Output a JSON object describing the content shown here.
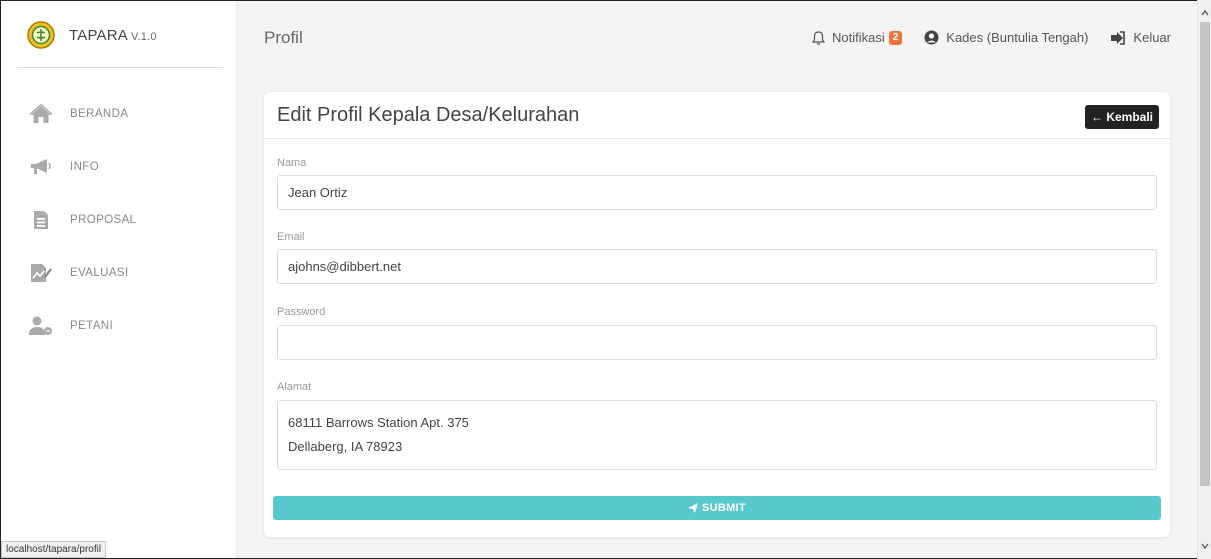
{
  "brand": {
    "name": "TAPARA",
    "version": "V.1.0"
  },
  "sidebar": {
    "items": [
      {
        "label": "BERANDA",
        "icon": "home-icon"
      },
      {
        "label": "INFO",
        "icon": "megaphone-icon"
      },
      {
        "label": "PROPOSAL",
        "icon": "document-icon"
      },
      {
        "label": "EVALUASI",
        "icon": "chart-pen-icon"
      },
      {
        "label": "PETANI",
        "icon": "user-group-icon"
      }
    ]
  },
  "topbar": {
    "title": "Profil",
    "notification_label": "Notifikasi",
    "notification_count": "2",
    "user_label": "Kades (Buntulia Tengah)",
    "logout_label": "Keluar"
  },
  "card": {
    "title": "Edit Profil Kepala Desa/Kelurahan",
    "back_label": "← Kembali",
    "fields": {
      "name_label": "Nama",
      "name_value": "Jean Ortiz",
      "email_label": "Email",
      "email_value": "ajohns@dibbert.net",
      "password_label": "Password",
      "password_value": "",
      "address_label": "Alamat",
      "address_value": "68111 Barrows Station Apt. 375\nDellaberg, IA 78923"
    },
    "submit_label": "SUBMIT"
  },
  "statusbar": {
    "url": "localhost/tapara/profil"
  },
  "colors": {
    "accent": "#57c9cc",
    "badge": "#f0743a",
    "back_button": "#222222"
  }
}
